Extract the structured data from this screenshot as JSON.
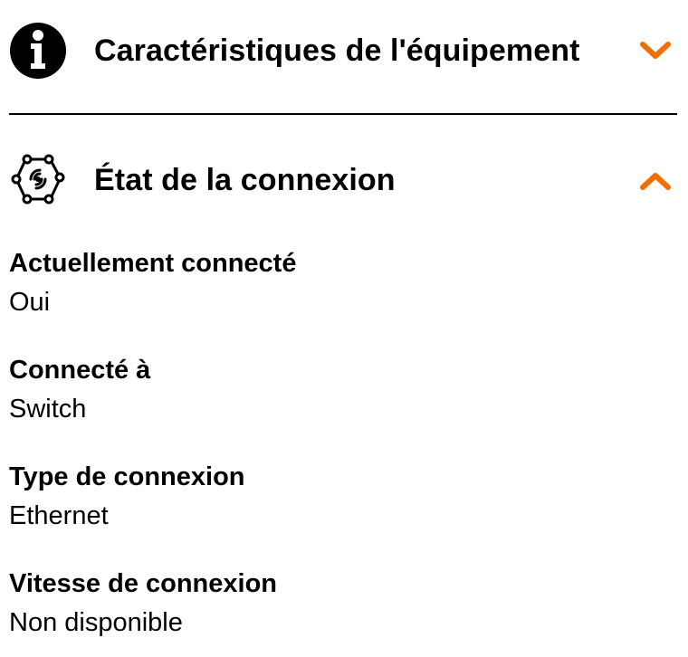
{
  "colors": {
    "accent": "#f16e00",
    "text": "#000000",
    "background": "#ffffff"
  },
  "sections": {
    "equipment": {
      "title": "Caractéristiques de l'équipement",
      "icon": "info-icon",
      "expanded": false
    },
    "connection": {
      "title": "État de la connexion",
      "icon": "connection-network-icon",
      "expanded": true,
      "fields": [
        {
          "label": "Actuellement connecté",
          "value": "Oui"
        },
        {
          "label": "Connecté à",
          "value": "Switch"
        },
        {
          "label": "Type de connexion",
          "value": "Ethernet"
        },
        {
          "label": "Vitesse de connexion",
          "value": "Non disponible"
        }
      ]
    }
  }
}
